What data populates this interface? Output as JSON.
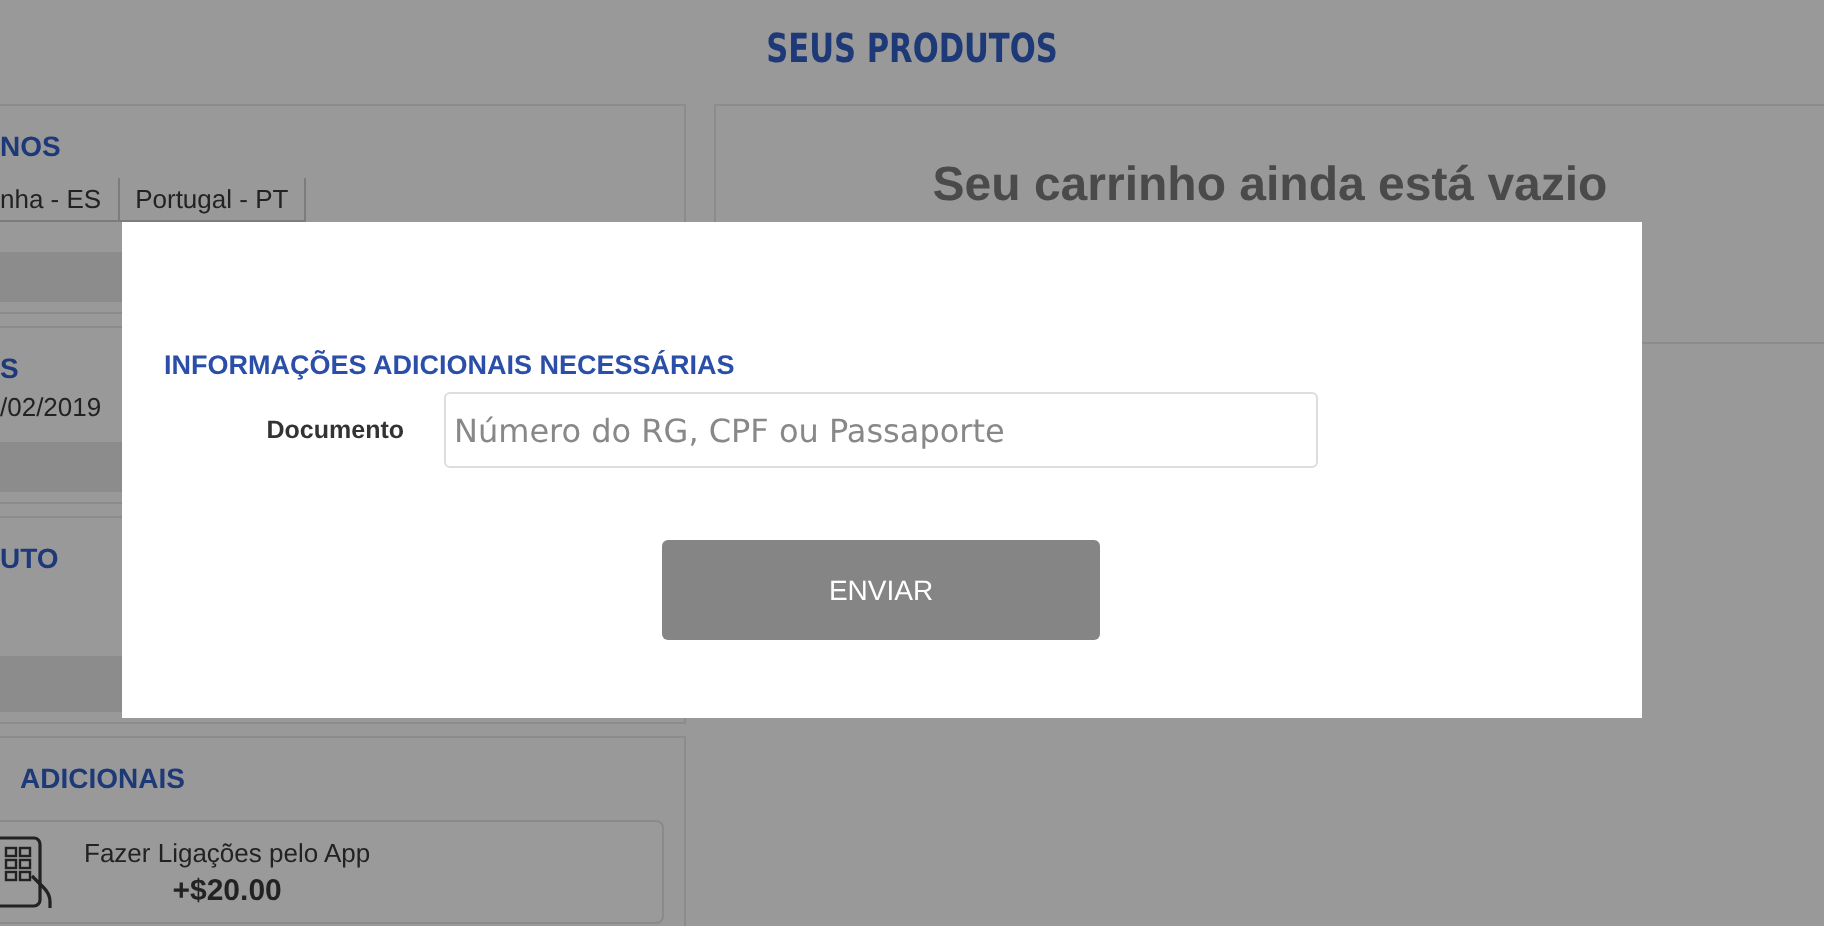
{
  "page_title": "SEUS PRODUTOS",
  "left_cards": [
    {
      "kind": "tabs",
      "heading": "NOS",
      "tabs": [
        {
          "label": "nha - ES"
        },
        {
          "label": "Portugal - PT"
        }
      ]
    },
    {
      "kind": "dates",
      "heading": "S",
      "texts": [
        "/02/2019"
      ]
    },
    {
      "kind": "plain",
      "heading": "UTO"
    },
    {
      "kind": "extras",
      "heading": "ADICIONAIS",
      "items": [
        {
          "name": "Fazer Ligações pelo App",
          "price": "+$20.00"
        }
      ]
    }
  ],
  "cart": {
    "message": "Seu carrinho ainda está vazio"
  },
  "modal": {
    "heading": "INFORMAÇÕES ADICIONAIS NECESSÁRIAS",
    "field_label": "Documento",
    "placeholder": "Número do RG, CPF ou Passaporte",
    "button": "ENVIAR"
  }
}
